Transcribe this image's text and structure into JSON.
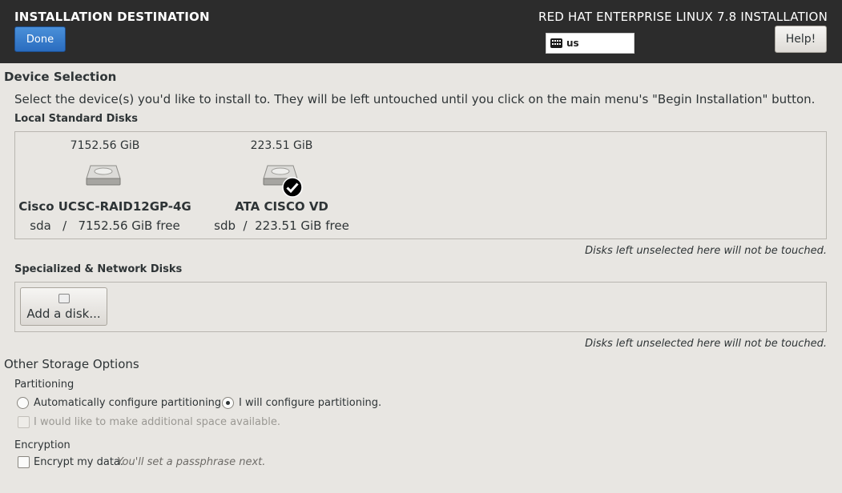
{
  "header": {
    "title": "INSTALLATION DESTINATION",
    "done_label": "Done",
    "product": "RED HAT ENTERPRISE LINUX 7.8 INSTALLATION",
    "keyboard_layout": "us",
    "help_label": "Help!"
  },
  "device_selection": {
    "heading": "Device Selection",
    "intro": "Select the device(s) you'd like to install to.  They will be left untouched until you click on the main menu's \"Begin Installation\" button.",
    "local_heading": "Local Standard Disks",
    "disks": [
      {
        "size": "7152.56 GiB",
        "name": "Cisco UCSC-RAID12GP-4G",
        "free": "sda   /   7152.56 GiB free",
        "selected": false
      },
      {
        "size": "223.51 GiB",
        "name": "ATA CISCO VD",
        "free": "sdb  /  223.51 GiB free",
        "selected": true
      }
    ],
    "untouched_note": "Disks left unselected here will not be touched.",
    "specialized_heading": "Specialized & Network Disks",
    "add_disk_label": "Add a disk...",
    "untouched_note2": "Disks left unselected here will not be touched."
  },
  "storage_options": {
    "heading": "Other Storage Options",
    "partitioning_heading": "Partitioning",
    "auto_label": "Automatically configure partitioning.",
    "manual_label": "I will configure partitioning.",
    "selected": "manual",
    "space_label": "I would like to make additional space available.",
    "encryption_heading": "Encryption",
    "encrypt_label": "Encrypt my data.",
    "encrypt_hint": "You'll set a passphrase next."
  }
}
